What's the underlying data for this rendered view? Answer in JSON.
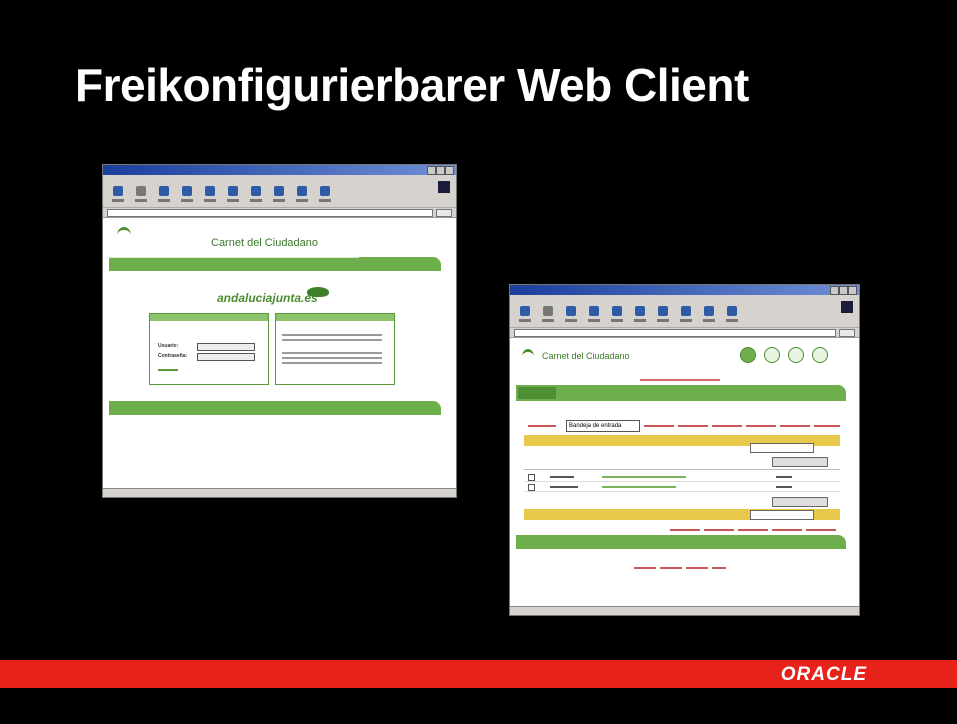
{
  "slide": {
    "title": "Freikonfigurierbarer Web Client",
    "footer_logo": "ORACLE"
  },
  "screenshot_left": {
    "site_title": "Carnet del Ciudadano",
    "brand_text": "andaluciajunta.es",
    "username_label": "Usuario:",
    "password_label": "Contraseña:"
  },
  "screenshot_right": {
    "site_title": "Carnet del Ciudadano",
    "folder_select_value": "Bandeja de entrada"
  },
  "colors": {
    "brand_green": "#6fae4c",
    "oracle_red": "#e6221b",
    "highlight_yellow": "#e8c84a"
  }
}
